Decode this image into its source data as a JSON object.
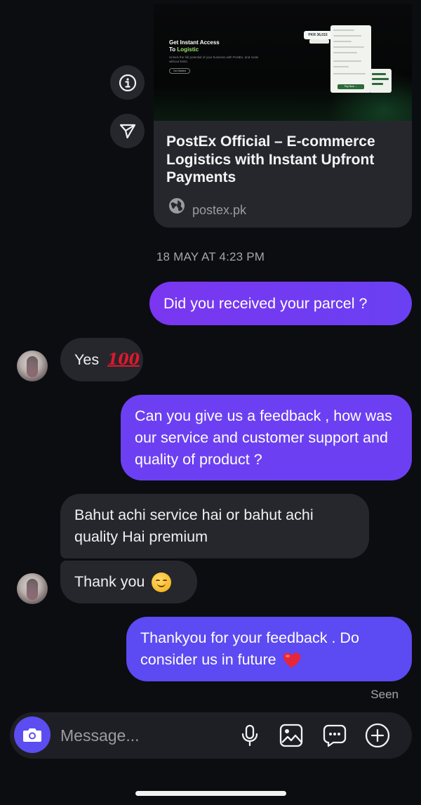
{
  "link_preview": {
    "image": {
      "headline_line1": "Get Instant Access",
      "headline_line2_prefix": "To ",
      "headline_line2_highlight": "Logistic",
      "subtext": "Unlock the full potential of your business with PostEx, and scale without limits.",
      "button": "Get Started",
      "price_tag": "PKR 36,015",
      "panel_button": "Pay Now →",
      "accent_color": "#9be36a"
    },
    "title": "PostEx Official – E-commerce Logistics with Instant Upfront Payments",
    "url": "postex.pk",
    "url_icon": "globe-icon"
  },
  "side_actions": {
    "info_icon": "info-icon",
    "share_icon": "send-icon"
  },
  "timestamp": "18 MAY AT 4:23 PM",
  "messages": [
    {
      "direction": "outgoing",
      "text": "Did you received your parcel ?"
    },
    {
      "direction": "incoming",
      "text": "Yes",
      "emoji": "💯"
    },
    {
      "direction": "outgoing",
      "text": "Can you give us a feedback , how was our service and customer support and quality of product ?"
    },
    {
      "direction": "incoming",
      "text": "Bahut achi service hai or bahut achi quality Hai premium"
    },
    {
      "direction": "incoming",
      "text": "Thank you",
      "emoji": "😊"
    },
    {
      "direction": "outgoing",
      "text": "Thankyou for your feedback . Do consider us in future",
      "emoji": "❤️"
    }
  ],
  "seen_label": "Seen",
  "composer": {
    "placeholder": "Message...",
    "camera_icon": "camera-icon",
    "tools": [
      "microphone-icon",
      "image-icon",
      "sticker-icon",
      "plus-icon"
    ]
  },
  "colors": {
    "background": "#0c0d11",
    "incoming_bubble": "#26272c",
    "outgoing_gradient_start": "#7a36f0",
    "outgoing_gradient_end": "#5c4af2",
    "camera_button": "#5b4df0"
  }
}
